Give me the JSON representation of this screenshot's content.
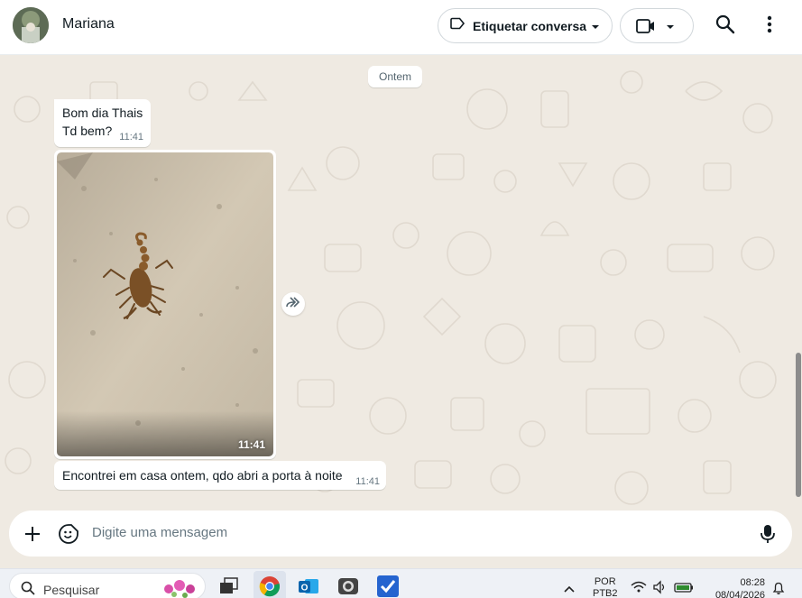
{
  "header": {
    "contact_name": "Mariana",
    "label_button": "Etiquetar conversa",
    "icons": [
      "label-icon",
      "chevron-down-icon",
      "video-call-icon",
      "search-icon",
      "more-vertical-icon"
    ]
  },
  "chat": {
    "date_separator": "Ontem",
    "messages": [
      {
        "line1": "Bom dia Thais",
        "line2": "Td bem?",
        "time": "11:41"
      },
      {
        "type": "image",
        "time": "11:41"
      },
      {
        "text": "Encontrei em casa ontem, qdo abri a porta à noite",
        "time": "11:41"
      }
    ]
  },
  "composer": {
    "placeholder": "Digite uma mensagem"
  },
  "taskbar": {
    "search_label": "Pesquisar",
    "lang_line1": "POR",
    "lang_line2": "PTB2",
    "time": "08:28",
    "date": "08/04/2026"
  },
  "colors": {
    "chat_bg": "#efeae2",
    "bubble_in": "#ffffff",
    "header_bg": "#ffffff"
  }
}
